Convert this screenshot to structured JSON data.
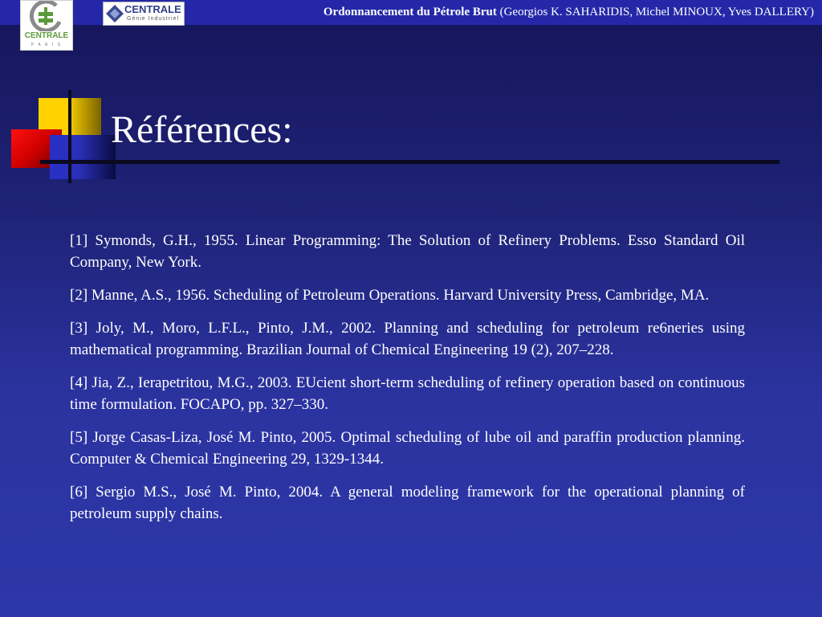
{
  "header": {
    "title_bold": "Ordonnancement du Pétrole Brut",
    "authors": "(Georgios K. SAHARIDIS, Michel MINOUX, Yves DALLERY)"
  },
  "logos": {
    "centrale_paris": {
      "word": "CENTRALE",
      "sub": "P A R I S"
    },
    "centrale_gi": {
      "word": "CENTRALE",
      "sub": "Génie Industriel"
    }
  },
  "colors": {
    "background": "#1f2378",
    "topbar": "#2428a8",
    "deco_yellow": "#ffd200",
    "deco_red": "#e00000",
    "deco_blue": "#2830c8"
  },
  "slide": {
    "title": "Références:",
    "references": [
      "[1] Symonds, G.H., 1955. Linear Programming: The Solution of Refinery Problems. Esso Standard Oil Company, New York.",
      "[2] Manne, A.S., 1956. Scheduling of Petroleum Operations. Harvard University Press, Cambridge, MA.",
      "[3] Joly, M., Moro, L.F.L., Pinto, J.M., 2002. Planning and scheduling for petroleum re6neries using mathematical programming. Brazilian Journal of Chemical Engineering 19 (2), 207–228.",
      "[4] Jia, Z., Ierapetritou, M.G., 2003. EUcient short-term scheduling of refinery operation based on continuous time formulation. FOCAPO, pp. 327–330.",
      "[5] Jorge Casas-Liza, José M. Pinto, 2005. Optimal scheduling of lube oil and paraffin production planning. Computer & Chemical Engineering 29, 1329-1344.",
      "[6] Sergio M.S., José M. Pinto, 2004. A general modeling framework for the operational planning of petroleum supply chains."
    ]
  }
}
